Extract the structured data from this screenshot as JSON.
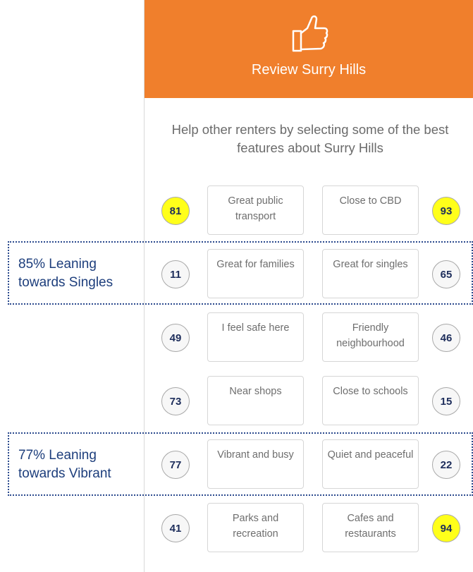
{
  "header": {
    "icon": "thumbs-up-icon",
    "title": "Review Surry Hills",
    "color": "#f07f2c"
  },
  "intro": "Help other renters by selecting some of the best features about Surry Hills",
  "features": [
    {
      "left": {
        "label": "Great public transport",
        "count": "81",
        "highlight": true
      },
      "right": {
        "label": "Close to CBD",
        "count": "93",
        "highlight": true
      }
    },
    {
      "left": {
        "label": "Great for families",
        "count": "11",
        "highlight": false
      },
      "right": {
        "label": "Great for singles",
        "count": "65",
        "highlight": false
      }
    },
    {
      "left": {
        "label": "I feel safe here",
        "count": "49",
        "highlight": false
      },
      "right": {
        "label": "Friendly neighbourhood",
        "count": "46",
        "highlight": false
      }
    },
    {
      "left": {
        "label": "Near shops",
        "count": "73",
        "highlight": false
      },
      "right": {
        "label": "Close to schools",
        "count": "15",
        "highlight": false
      }
    },
    {
      "left": {
        "label": "Vibrant and busy",
        "count": "77",
        "highlight": false
      },
      "right": {
        "label": "Quiet and peaceful",
        "count": "22",
        "highlight": false
      }
    },
    {
      "left": {
        "label": "Parks and recreation",
        "count": "41",
        "highlight": false
      },
      "right": {
        "label": "Cafes and restaurants",
        "count": "94",
        "highlight": true
      }
    }
  ],
  "callouts": [
    {
      "line1": "85% Leaning",
      "line2": "towards Singles"
    },
    {
      "line1": "77% Leaning",
      "line2": "towards Vibrant"
    }
  ],
  "colors": {
    "highlight": "#ffff1a",
    "callout_border": "#2b4a8e",
    "callout_text": "#1d3e7c"
  }
}
